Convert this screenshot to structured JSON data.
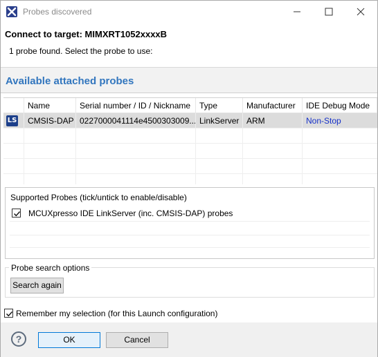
{
  "window": {
    "title": "Probes discovered"
  },
  "header": {
    "title": "Connect to target: MIMXRT1052xxxxB",
    "message": "1 probe found. Select the probe to use:"
  },
  "section": {
    "title": "Available attached probes"
  },
  "table": {
    "columns": [
      "",
      "Name",
      "Serial number / ID / Nickname",
      "Type",
      "Manufacturer",
      "IDE Debug Mode"
    ],
    "rows": [
      {
        "icon_text": "LS",
        "icon": "linkserver-icon",
        "name": "CMSIS-DAP",
        "serial": "0227000041114e4500303009...",
        "type": "LinkServer",
        "manufacturer": "ARM",
        "debug_mode": "Non-Stop"
      }
    ]
  },
  "supported_probes": {
    "title": "Supported Probes (tick/untick to enable/disable)",
    "items": [
      {
        "label": "MCUXpresso IDE LinkServer (inc. CMSIS-DAP) probes",
        "checked": true
      }
    ]
  },
  "search_options": {
    "legend": "Probe search options",
    "search_button": "Search again"
  },
  "remember": {
    "label": "Remember my selection (for this Launch configuration)",
    "checked": true
  },
  "footer": {
    "help_icon": "question-icon",
    "help_glyph": "?",
    "ok_label": "OK",
    "cancel_label": "Cancel"
  },
  "colors": {
    "section_title": "#3276be",
    "link": "#1530c8",
    "selected_row": "#dcdcdc",
    "default_button_border": "#0078d7"
  }
}
